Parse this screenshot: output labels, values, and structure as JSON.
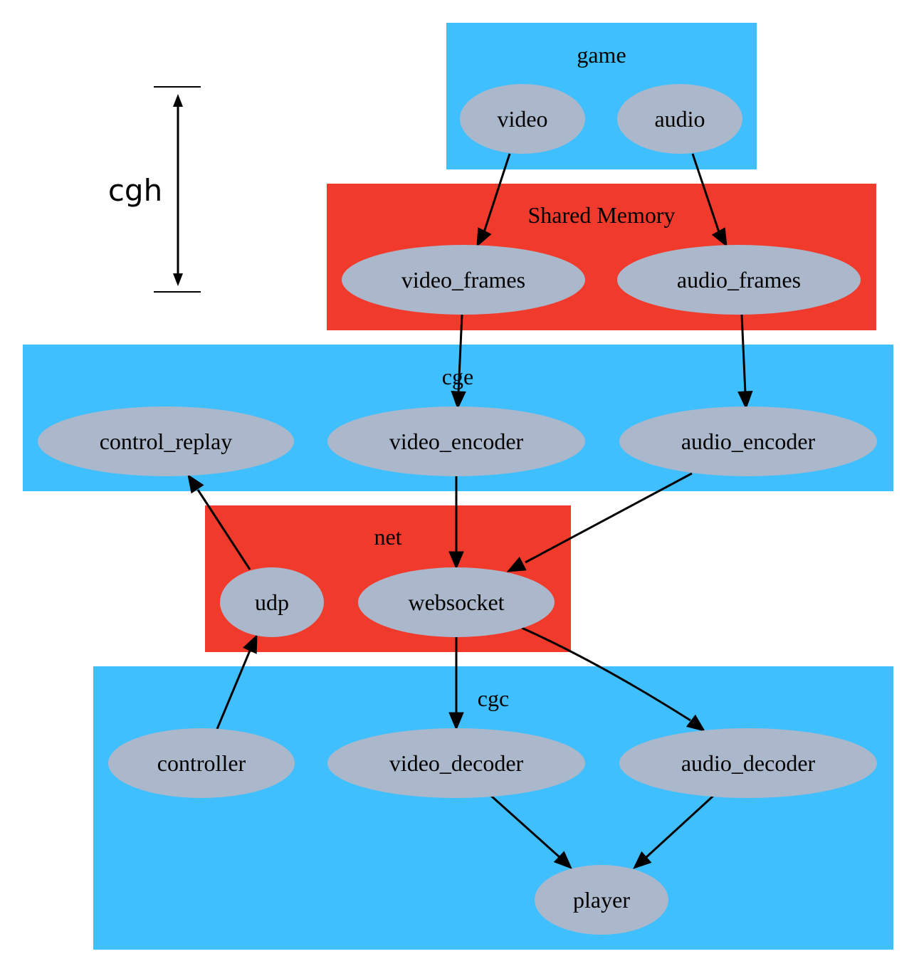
{
  "colors": {
    "blue_cluster": "#40bfff",
    "red_cluster": "#f03a2b",
    "node_fill": "#abb7ca",
    "edge": "#000000"
  },
  "side_annotation": {
    "label": "cgh"
  },
  "clusters": [
    {
      "id": "game",
      "label": "game",
      "color": "blue"
    },
    {
      "id": "shm",
      "label": "Shared Memory",
      "color": "red"
    },
    {
      "id": "cge",
      "label": "cge",
      "color": "blue"
    },
    {
      "id": "net",
      "label": "net",
      "color": "red"
    },
    {
      "id": "cgc",
      "label": "cgc",
      "color": "blue"
    }
  ],
  "nodes": [
    {
      "id": "video",
      "label": "video",
      "cluster": "game"
    },
    {
      "id": "audio",
      "label": "audio",
      "cluster": "game"
    },
    {
      "id": "video_frames",
      "label": "video_frames",
      "cluster": "shm"
    },
    {
      "id": "audio_frames",
      "label": "audio_frames",
      "cluster": "shm"
    },
    {
      "id": "control_replay",
      "label": "control_replay",
      "cluster": "cge"
    },
    {
      "id": "video_encoder",
      "label": "video_encoder",
      "cluster": "cge"
    },
    {
      "id": "audio_encoder",
      "label": "audio_encoder",
      "cluster": "cge"
    },
    {
      "id": "udp",
      "label": "udp",
      "cluster": "net"
    },
    {
      "id": "websocket",
      "label": "websocket",
      "cluster": "net"
    },
    {
      "id": "controller",
      "label": "controller",
      "cluster": "cgc"
    },
    {
      "id": "video_decoder",
      "label": "video_decoder",
      "cluster": "cgc"
    },
    {
      "id": "audio_decoder",
      "label": "audio_decoder",
      "cluster": "cgc"
    },
    {
      "id": "player",
      "label": "player",
      "cluster": "cgc"
    }
  ],
  "edges": [
    {
      "from": "video",
      "to": "video_frames"
    },
    {
      "from": "audio",
      "to": "audio_frames"
    },
    {
      "from": "video_frames",
      "to": "video_encoder"
    },
    {
      "from": "audio_frames",
      "to": "audio_encoder"
    },
    {
      "from": "video_encoder",
      "to": "websocket"
    },
    {
      "from": "audio_encoder",
      "to": "websocket"
    },
    {
      "from": "udp",
      "to": "control_replay"
    },
    {
      "from": "controller",
      "to": "udp"
    },
    {
      "from": "websocket",
      "to": "video_decoder"
    },
    {
      "from": "websocket",
      "to": "audio_decoder"
    },
    {
      "from": "video_decoder",
      "to": "player"
    },
    {
      "from": "audio_decoder",
      "to": "player"
    }
  ]
}
